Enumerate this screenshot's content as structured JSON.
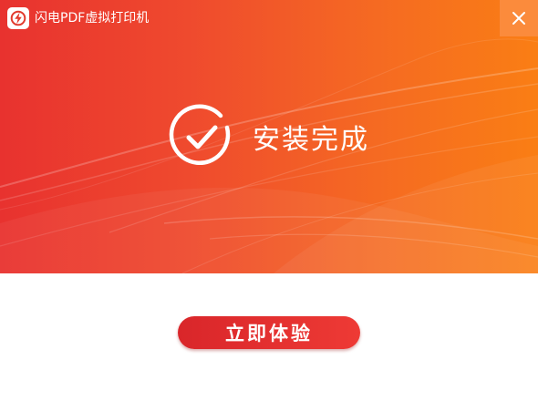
{
  "window": {
    "title": "闪电PDF虚拟打印机",
    "close_icon": "close-icon",
    "logo_icon": "lightning-logo-icon"
  },
  "status": {
    "icon": "check-circle-icon",
    "text": "安装完成"
  },
  "action": {
    "primary_label": "立即体验"
  },
  "colors": {
    "banner_start": "#e8322f",
    "banner_end": "#fa7e14",
    "close_bg": "#fb8b3c",
    "button": "#e0302e",
    "background": "#ffffff"
  }
}
